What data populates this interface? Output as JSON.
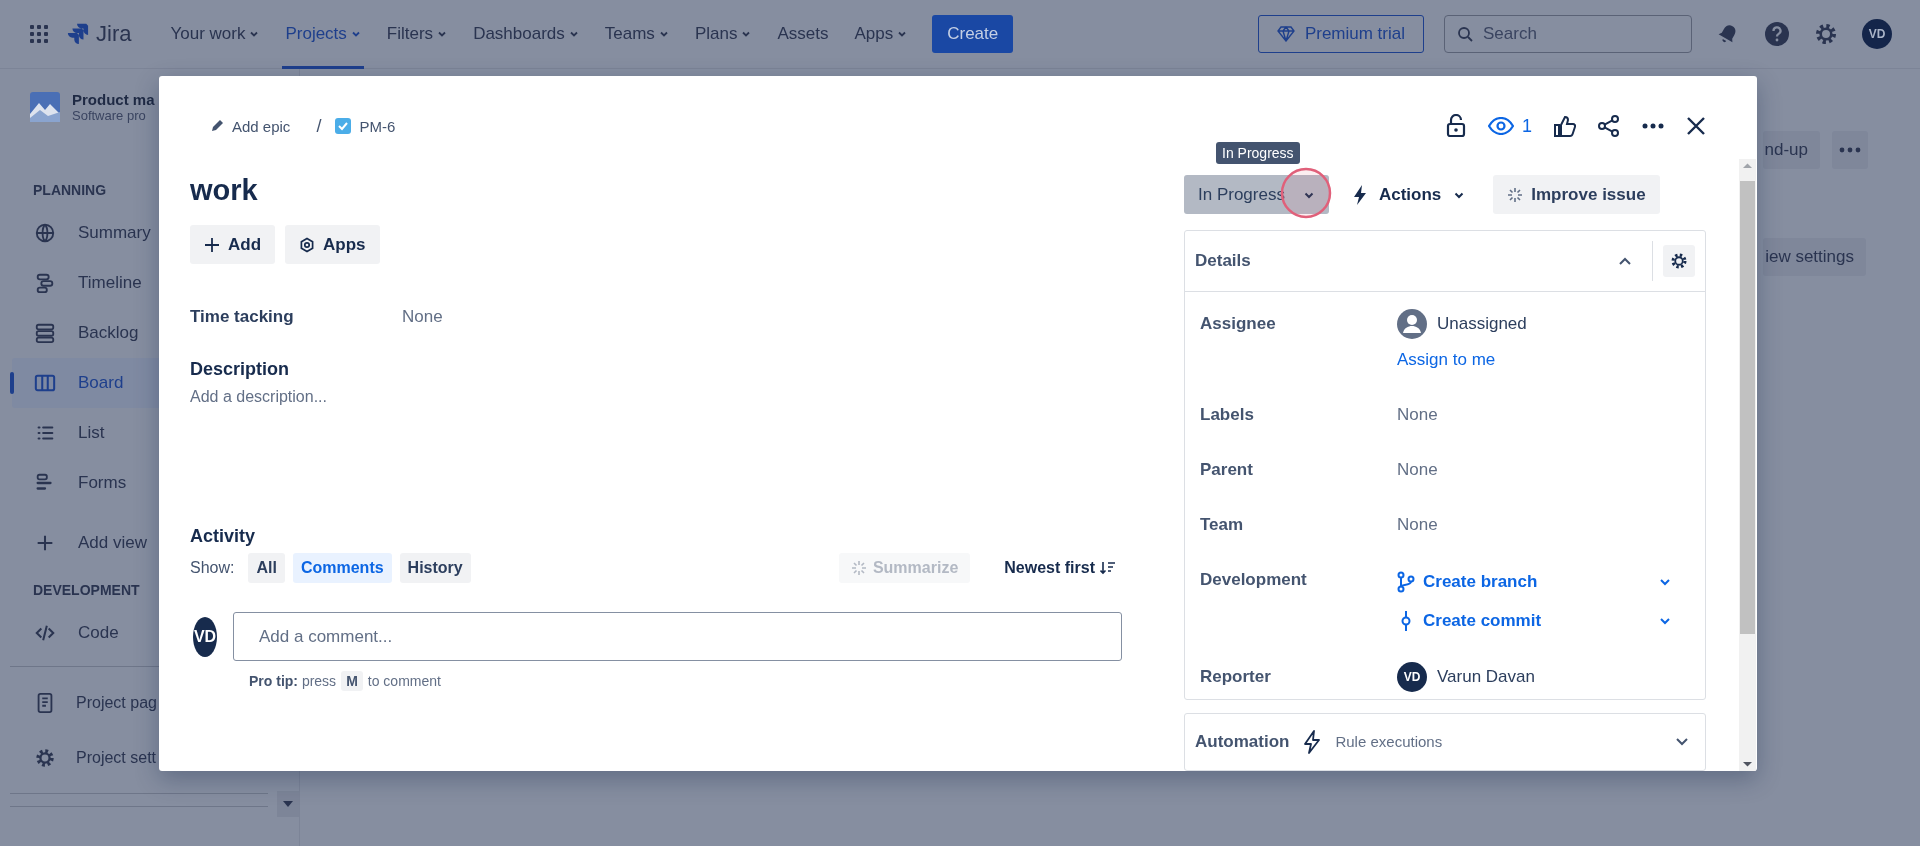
{
  "top_nav": {
    "product": "Jira",
    "items": [
      {
        "label": "Your work",
        "dropdown": true,
        "selected": false
      },
      {
        "label": "Projects",
        "dropdown": true,
        "selected": true
      },
      {
        "label": "Filters",
        "dropdown": true,
        "selected": false
      },
      {
        "label": "Dashboards",
        "dropdown": true,
        "selected": false
      },
      {
        "label": "Teams",
        "dropdown": true,
        "selected": false
      },
      {
        "label": "Plans",
        "dropdown": true,
        "selected": false
      },
      {
        "label": "Assets",
        "dropdown": false,
        "selected": false
      },
      {
        "label": "Apps",
        "dropdown": true,
        "selected": false
      }
    ],
    "create_button": "Create",
    "premium_button": "Premium trial",
    "search": {
      "placeholder": "Search"
    },
    "avatar": "VD"
  },
  "sidebar": {
    "project": {
      "name": "Product ma",
      "type": "Software pro"
    },
    "groups": [
      {
        "heading": "PLANNING",
        "items": [
          {
            "label": "Summary",
            "selected": false
          },
          {
            "label": "Timeline",
            "selected": false
          },
          {
            "label": "Backlog",
            "selected": false
          },
          {
            "label": "Board",
            "selected": true
          },
          {
            "label": "List",
            "selected": false
          },
          {
            "label": "Forms",
            "selected": false
          },
          {
            "label": "Add view",
            "selected": false
          }
        ]
      },
      {
        "heading": "DEVELOPMENT",
        "items": [
          {
            "label": "Code",
            "selected": false
          }
        ]
      },
      {
        "items": [
          {
            "label": "Project pag",
            "selected": false
          },
          {
            "label": "Project sett",
            "selected": false
          }
        ]
      }
    ]
  },
  "board_toolbar": {
    "buttons": [
      "nd-up",
      "iew settings"
    ]
  },
  "issue": {
    "breadcrumb": {
      "epic": "Add epic",
      "separator": "/",
      "key": "PM-6"
    },
    "watchers": "1",
    "title": "work",
    "quick_buttons": [
      "Add",
      "Apps"
    ],
    "fields": [
      {
        "label": "Time tacking",
        "value": "None"
      }
    ],
    "description": {
      "heading": "Description",
      "placeholder": "Add a description..."
    },
    "activity": {
      "heading": "Activity",
      "show_label": "Show:",
      "filters": [
        {
          "label": "All",
          "selected": false
        },
        {
          "label": "Comments",
          "selected": true
        },
        {
          "label": "History",
          "selected": false
        }
      ],
      "summarize": {
        "label": "Summarize",
        "disabled": true
      },
      "sort": "Newest first",
      "comment": {
        "avatar": "VD",
        "placeholder": "Add a comment...",
        "tip": "**Pro tip:** press",
        "key": "M",
        "tip_end": "to comment"
      }
    },
    "tooltip": "In Progress",
    "status": "In Progress",
    "actions": "Actions",
    "improve": "Improve issue",
    "details": {
      "heading": "Details",
      "expanded": true,
      "rows": [
        {
          "kind": "person",
          "label": "Assignee",
          "value": "Unassigned",
          "link": "Assign to me"
        },
        {
          "kind": "text",
          "label": "Labels",
          "value": "None"
        },
        {
          "kind": "text",
          "label": "Parent",
          "value": "None"
        },
        {
          "kind": "text",
          "label": "Team",
          "value": "None"
        },
        {
          "kind": "dev",
          "label": "Development",
          "links": [
            "Create branch",
            "Create commit"
          ]
        },
        {
          "kind": "person",
          "label": "Reporter",
          "value": "Varun Davan",
          "avatar": "VD"
        }
      ]
    },
    "automation": {
      "heading": "Automation",
      "subtitle": "Rule executions",
      "expanded": false
    }
  }
}
